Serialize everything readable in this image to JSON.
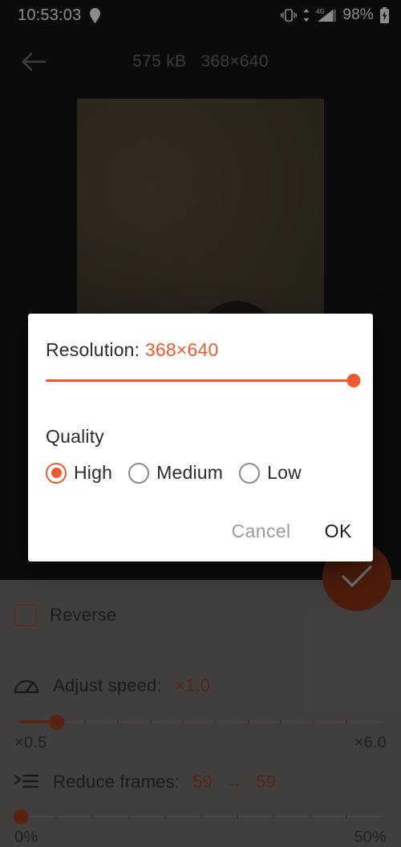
{
  "status_bar": {
    "clock": "10:53:03",
    "location_icon": "location-pin-icon",
    "vibrate_icon": "vibrate-icon",
    "data_icon": "data-transfer-icon",
    "network_label": "4G",
    "signal_icon": "signal-bars-icon",
    "battery_percent": "98%",
    "battery_icon": "battery-charging-icon"
  },
  "appbar": {
    "back_icon": "arrow-left-icon",
    "file_size": "575 kB",
    "dimensions": "368×640"
  },
  "dialog": {
    "resolution_label": "Resolution:",
    "resolution_value": "368×640",
    "resolution_slider": {
      "percent": 100,
      "min_label": "",
      "max_label": ""
    },
    "quality_label": "Quality",
    "quality_options": [
      {
        "label": "High",
        "selected": true
      },
      {
        "label": "Medium",
        "selected": false
      },
      {
        "label": "Low",
        "selected": false
      }
    ],
    "cancel_label": "Cancel",
    "ok_label": "OK"
  },
  "tools": {
    "reverse": {
      "label": "Reverse",
      "checked": false
    },
    "adjust_speed": {
      "icon": "speedometer-icon",
      "label": "Adjust speed:",
      "value": "×1.0",
      "slider": {
        "percent": 9,
        "min_label": "×0.5",
        "max_label": "×6.0"
      }
    },
    "reduce_frames": {
      "icon": "list-indent-icon",
      "label": "Reduce frames:",
      "value_from": "59",
      "value_arrow": "→",
      "value_to": "59",
      "slider": {
        "percent": 0,
        "min_label": "0%",
        "max_label": "50%"
      }
    },
    "confirm_fab": {
      "icon": "check-icon"
    }
  },
  "colors": {
    "accent": "#ef5a2d",
    "accent_dim": "#a0401c",
    "panel": "#777471",
    "background": "#141414",
    "dialog_bg": "#ffffff"
  }
}
